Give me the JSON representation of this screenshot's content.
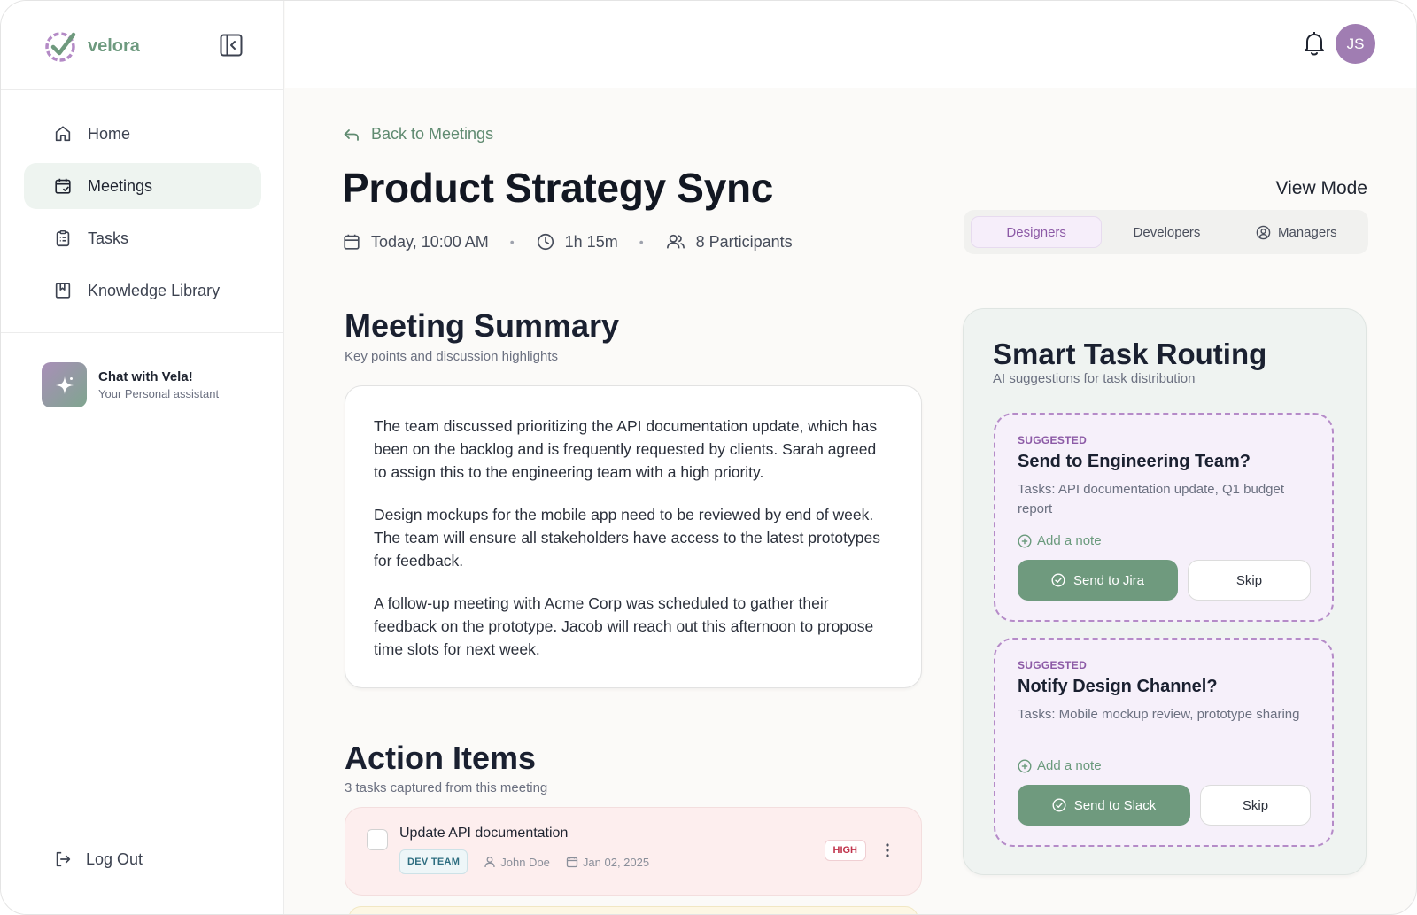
{
  "app": {
    "name": "velora"
  },
  "sidebar": {
    "items": [
      {
        "label": "Home",
        "icon": "home-icon"
      },
      {
        "label": "Meetings",
        "icon": "calendar-check-icon",
        "active": true
      },
      {
        "label": "Tasks",
        "icon": "clipboard-icon"
      },
      {
        "label": "Knowledge Library",
        "icon": "bookmark-icon"
      }
    ],
    "chat": {
      "title": "Chat with Vela!",
      "subtitle": "Your Personal assistant"
    },
    "logout_label": "Log Out"
  },
  "topbar": {
    "avatar_initials": "JS"
  },
  "page": {
    "back_label": "Back to Meetings",
    "title": "Product Strategy Sync",
    "meta": {
      "time": "Today, 10:00 AM",
      "duration": "1h 15m",
      "participants": "8 Participants"
    }
  },
  "view_mode": {
    "label": "View Mode",
    "tabs": [
      {
        "label": "Designers",
        "active": true
      },
      {
        "label": "Developers"
      },
      {
        "label": "Managers",
        "icon": "user-circle-icon"
      }
    ]
  },
  "summary": {
    "title": "Meeting Summary",
    "subtitle": "Key points and discussion highlights",
    "paragraphs": [
      "The team discussed prioritizing the API documentation update, which has been on the backlog and is frequently requested by clients. Sarah agreed to assign this to the engineering team with a high priority.",
      "Design mockups for the mobile app need to be reviewed by end of week. The team will ensure all stakeholders have access to the latest prototypes for feedback.",
      "A follow-up meeting with Acme Corp was scheduled to gather their feedback on the prototype. Jacob will reach out this afternoon to propose time slots for next week."
    ]
  },
  "action_items": {
    "title": "Action Items",
    "subtitle": "3 tasks captured from this meeting",
    "items": [
      {
        "title": "Update API documentation",
        "team": "DEV TEAM",
        "assignee": "John Doe",
        "due": "Jan 02, 2025",
        "priority": "HIGH"
      }
    ]
  },
  "routing": {
    "title": "Smart Task Routing",
    "subtitle": "AI suggestions for task distribution",
    "suggestions": [
      {
        "label": "SUGGESTED",
        "title": "Send to Engineering Team?",
        "tasks": "Tasks: API documentation update, Q1 budget report",
        "note": "Add a note",
        "primary": "Send to Jira",
        "skip": "Skip"
      },
      {
        "label": "SUGGESTED",
        "title": "Notify Design Channel?",
        "tasks": "Tasks: Mobile mockup review, prototype sharing",
        "note": "Add a note",
        "primary": "Send to Slack",
        "skip": "Skip"
      }
    ]
  },
  "colors": {
    "accent_green": "#6f9a7e",
    "accent_purple": "#8c5aa6",
    "avatar": "#a07db2",
    "priority_high": "#c0334b"
  }
}
